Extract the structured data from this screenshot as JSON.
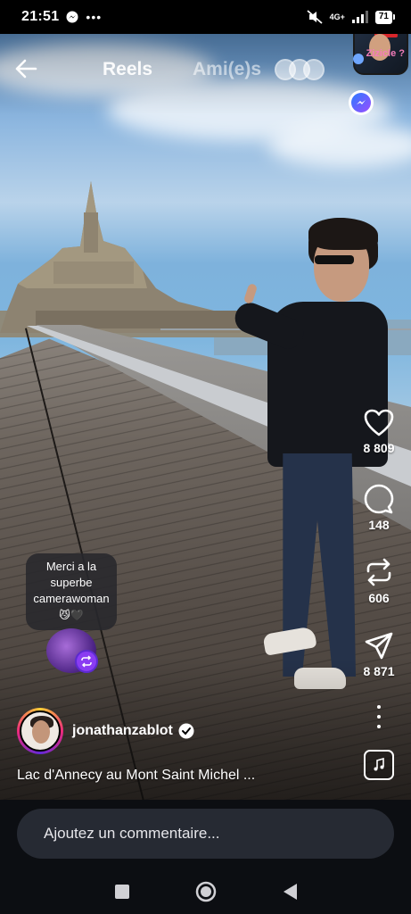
{
  "status_bar": {
    "time": "21:51",
    "network": "4G+",
    "battery": "71"
  },
  "header": {
    "tab_reels": "Reels",
    "tab_friends": "Ami(e)s",
    "story_text": "Zizicle ?"
  },
  "actions": {
    "likes": "8 809",
    "comments": "148",
    "reposts": "606",
    "shares": "8 871"
  },
  "bubble": {
    "text": "Merci a la superbe camerawoman",
    "emoji": "😼🖤"
  },
  "author": {
    "username": "jonathanzablot",
    "verified": true
  },
  "caption": "Lac d'Annecy au Mont Saint Michel ...",
  "comment": {
    "placeholder": "Ajoutez un commentaire..."
  },
  "icons": {
    "back": "arrow-left-icon",
    "like": "heart-icon",
    "comment": "speech-bubble-icon",
    "repost": "repost-icon",
    "share": "send-icon",
    "more": "more-icon",
    "music": "music-note-icon"
  }
}
